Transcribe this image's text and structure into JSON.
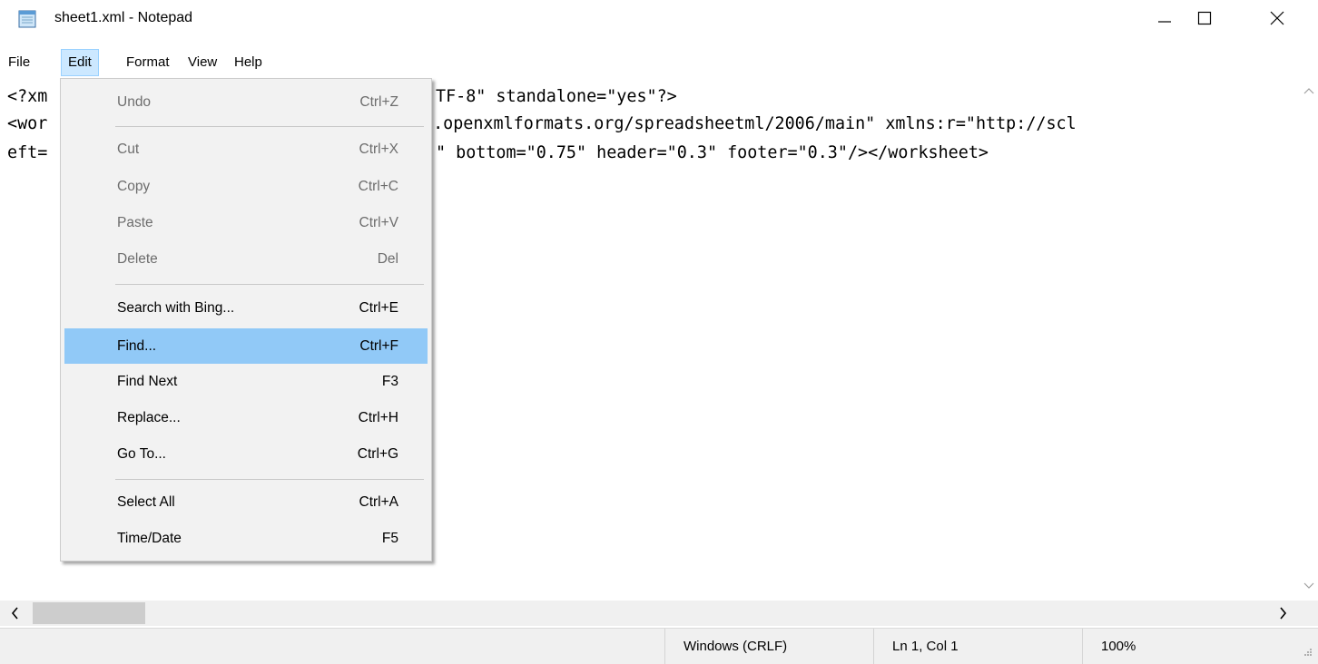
{
  "window": {
    "title": "sheet1.xml - Notepad",
    "icon": "notepad-icon"
  },
  "menubar": {
    "items": [
      "File",
      "Edit",
      "Format",
      "View",
      "Help"
    ],
    "active": "Edit"
  },
  "editor": {
    "lines": [
      "<?xml version=\"1.0\" encoding=\"UTF-8\" standalone=\"yes\"?>",
      "<worksheet xmlns=\"http://schemas.openxmlformats.org/spreadsheetml/2006/main\" xmlns:r=\"http://sch",
      "eft=\"0.7\" right=\"0.7\" top=\"0.75\" bottom=\"0.75\" header=\"0.3\" footer=\"0.3\"/></worksheet>"
    ],
    "visible_fragments": [
      {
        "left": "<?xm",
        "right": "TF-8\" standalone=\"yes\"?>"
      },
      {
        "left": "<wor",
        "right": "s.openxmlformats.org/spreadsheetml/2006/main\" xmlns:r=\"http://scl"
      },
      {
        "left": "eft=",
        "right": "\" bottom=\"0.75\" header=\"0.3\" footer=\"0.3\"/></worksheet>"
      }
    ]
  },
  "edit_menu": {
    "items": [
      {
        "label": "Undo",
        "shortcut": "Ctrl+Z",
        "disabled": true
      },
      {
        "label": "Cut",
        "shortcut": "Ctrl+X",
        "disabled": true
      },
      {
        "label": "Copy",
        "shortcut": "Ctrl+C",
        "disabled": true
      },
      {
        "label": "Paste",
        "shortcut": "Ctrl+V",
        "disabled": true
      },
      {
        "label": "Delete",
        "shortcut": "Del",
        "disabled": true
      },
      {
        "label": "Search with Bing...",
        "shortcut": "Ctrl+E",
        "disabled": false
      },
      {
        "label": "Find...",
        "shortcut": "Ctrl+F",
        "disabled": false,
        "highlighted": true
      },
      {
        "label": "Find Next",
        "shortcut": "F3",
        "disabled": false
      },
      {
        "label": "Replace...",
        "shortcut": "Ctrl+H",
        "disabled": false
      },
      {
        "label": "Go To...",
        "shortcut": "Ctrl+G",
        "disabled": false
      },
      {
        "label": "Select All",
        "shortcut": "Ctrl+A",
        "disabled": false
      },
      {
        "label": "Time/Date",
        "shortcut": "F5",
        "disabled": false
      }
    ]
  },
  "statusbar": {
    "line_ending": "Windows (CRLF)",
    "position": "Ln 1, Col 1",
    "zoom": "100%"
  },
  "colors": {
    "menu_highlight": "#91c9f7",
    "menubar_active": "#cce8ff",
    "disabled_text": "#6d6d6d"
  }
}
